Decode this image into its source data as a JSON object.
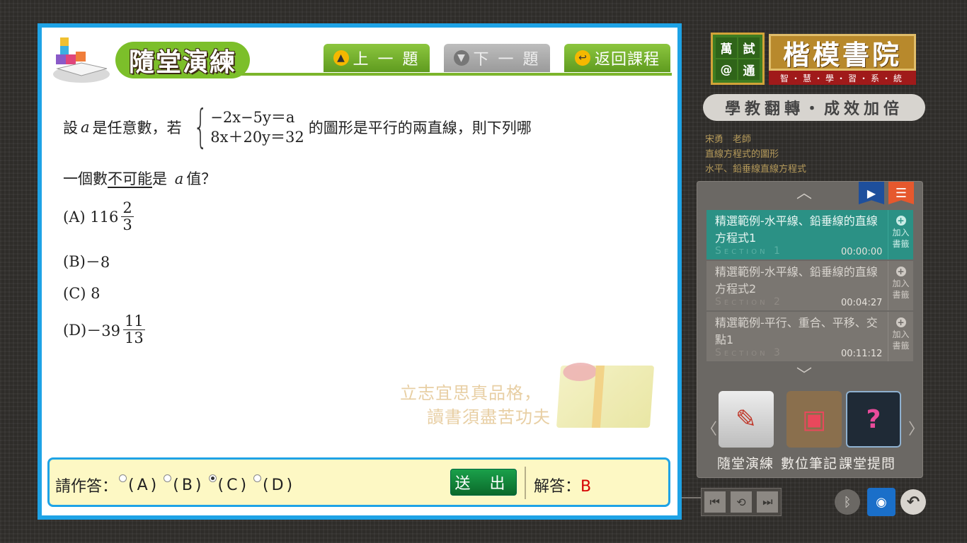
{
  "header": {
    "title": "隨堂演練",
    "prev_label": "上 一 題",
    "next_label": "下 一 題",
    "back_label": "返回課程"
  },
  "question": {
    "line1_pre": "設",
    "var_a": "a",
    "line1_mid": "是任意數，若",
    "eq1": "−2x−5y＝a",
    "eq2": "8x＋20y＝32",
    "line1_post": "的圖形是平行的兩直線，則下列哪",
    "line2_pre": "一個數",
    "line2_under": "不可能",
    "line2_mid": "是",
    "line2_post": "值？",
    "options": [
      {
        "label": "(A)",
        "whole": "116",
        "num": "2",
        "den": "3"
      },
      {
        "label": "(B)",
        "text": "－8"
      },
      {
        "label": "(C)",
        "text": "8"
      },
      {
        "label": "(D)",
        "whole": "－39",
        "num": "11",
        "den": "13"
      }
    ]
  },
  "watermark": {
    "line1": "立志宜思真品格，",
    "line2": "讀書須盡苦功夫"
  },
  "answer": {
    "prompt": "請作答：",
    "choices": [
      "(A)",
      "(B)",
      "(C)",
      "(D)"
    ],
    "selected": "(C)",
    "submit_label": "送 出",
    "solution_label": "解答：",
    "solution_value": "B"
  },
  "brand": {
    "box_chars": [
      "萬",
      "試",
      "@",
      "通"
    ],
    "name": "楷模書院",
    "subtitle": "智・慧・學・習・系・統",
    "slogan": "學教翻轉・成效加倍"
  },
  "course": {
    "teacher": "宋勇　老師",
    "chapter": "直線方程式的圖形",
    "topic": "水平、鉛垂線直線方程式"
  },
  "sections": [
    {
      "title": "精選範例-水平線、鉛垂線的直線方程式1",
      "label": "Section 1",
      "time": "00:00:00",
      "bookmark": "加入書籤"
    },
    {
      "title": "精選範例-水平線、鉛垂線的直線方程式2",
      "label": "Section 2",
      "time": "00:04:27",
      "bookmark": "加入書籤"
    },
    {
      "title": "精選範例-平行、重合、平移、交點1",
      "label": "Section 3",
      "time": "00:11:12",
      "bookmark": "加入書籤"
    }
  ],
  "tools": {
    "practice": "隨堂演練",
    "notes": "數位筆記",
    "ask": "課堂提問"
  },
  "colors": {
    "panel_border": "#1ea3e6",
    "green_button": "#7cb52b",
    "active_section": "#2b9185",
    "solution_value": "#d60000"
  }
}
